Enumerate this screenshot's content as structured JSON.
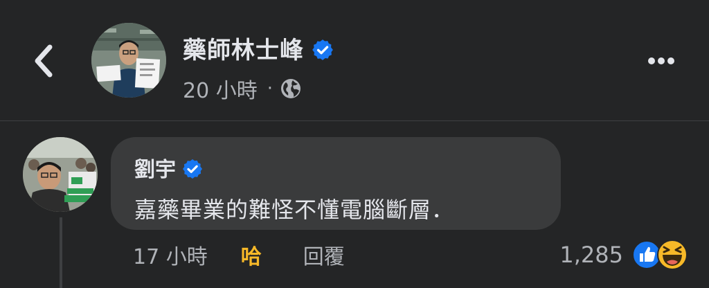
{
  "post": {
    "author": "藥師林士峰",
    "time": "20 小時",
    "dot": "·",
    "audience_icon": "globe-icon"
  },
  "comment": {
    "author": "劉宇",
    "text": "嘉藥畢業的難怪不懂電腦斷層．",
    "time": "17 小時",
    "reaction_label": "哈",
    "reply_label": "回覆",
    "reaction_count": "1,285",
    "reaction_icons": [
      "like-icon",
      "haha-icon"
    ]
  },
  "colors": {
    "background": "#242526",
    "bubble": "#3a3b3c",
    "verified": "#1877f2",
    "haha": "#f7b928"
  }
}
